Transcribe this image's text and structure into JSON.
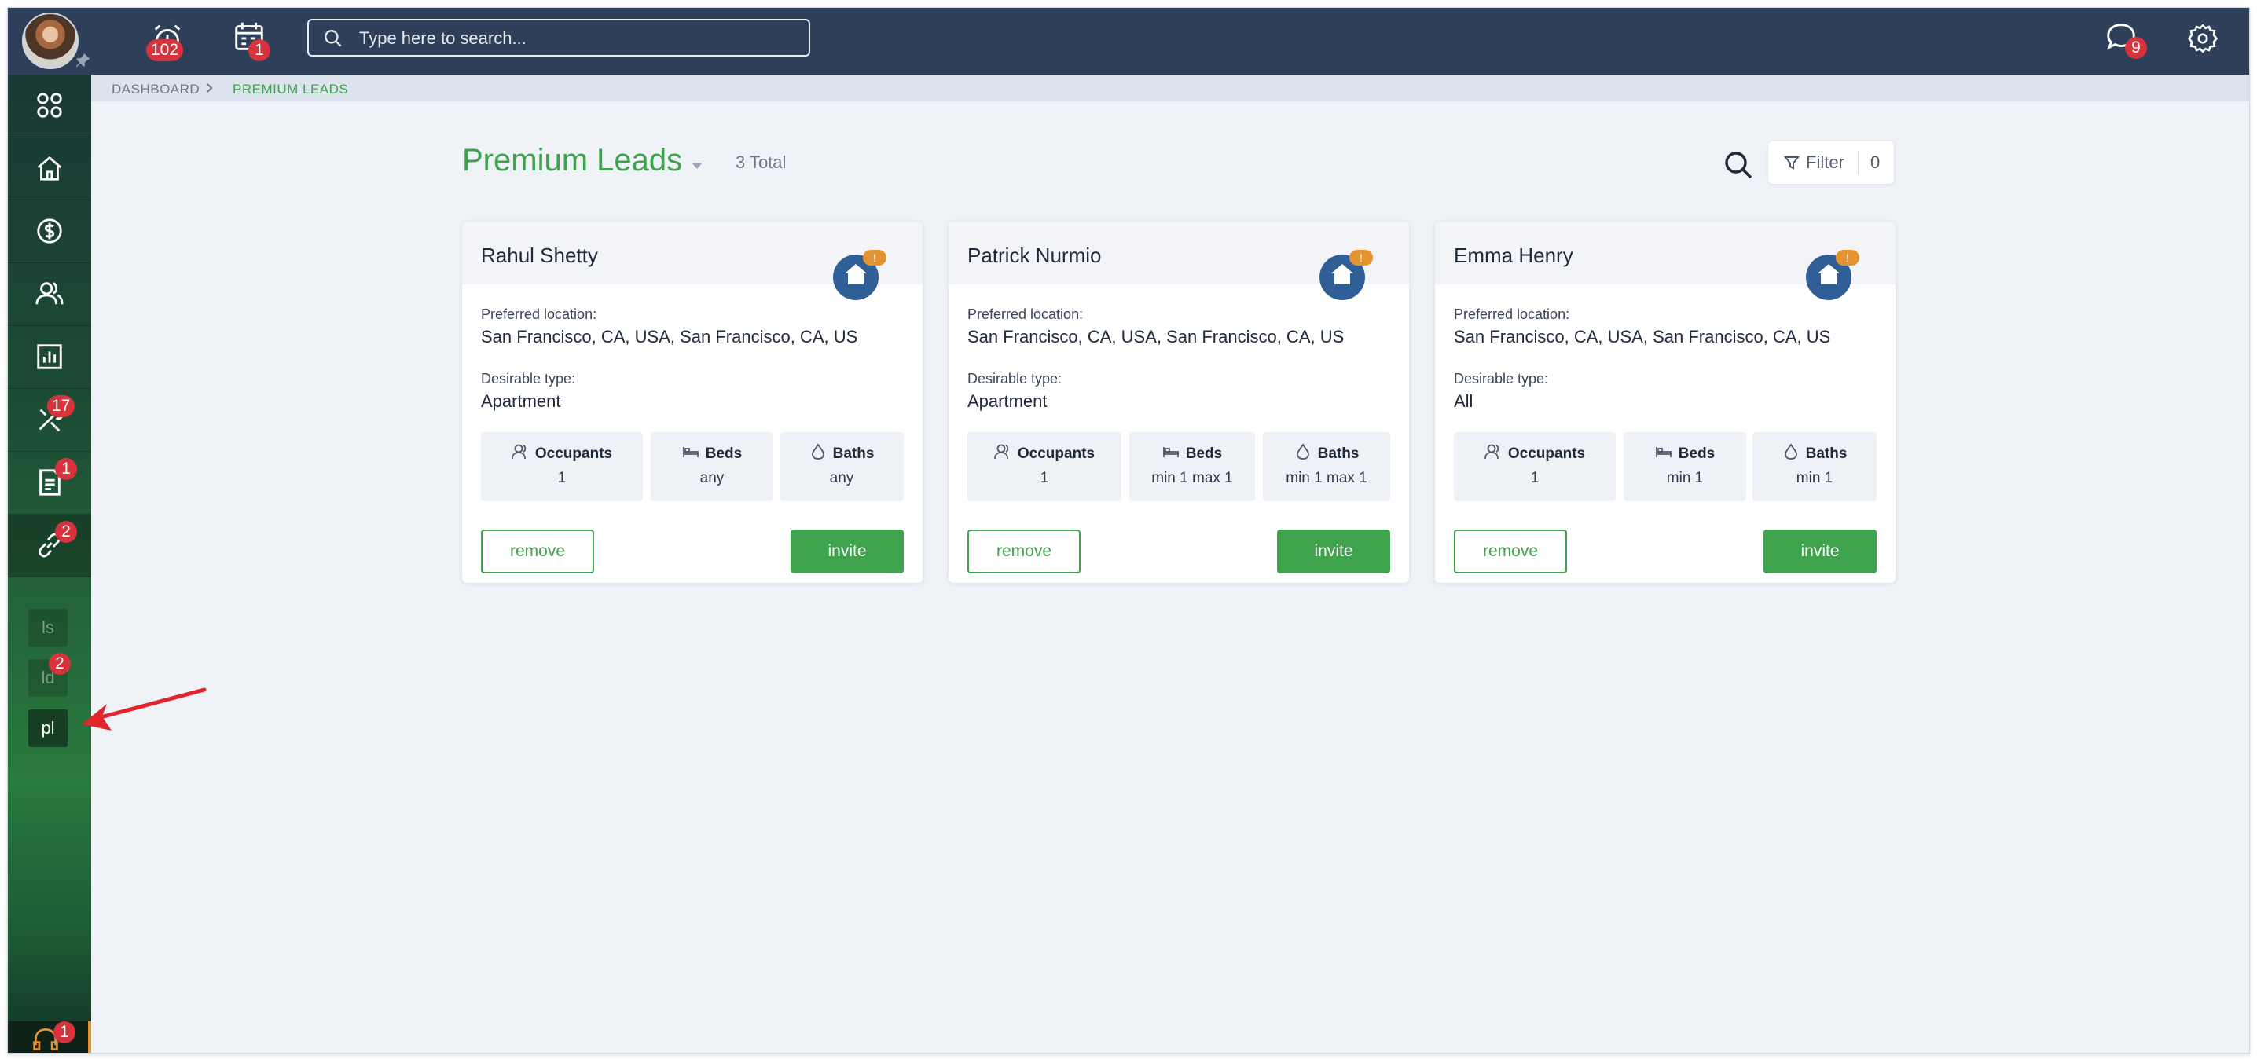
{
  "topbar": {
    "alarm_badge": "102",
    "calendar_badge": "1",
    "search_placeholder": "Type here to search...",
    "chat_badge": "9"
  },
  "sidebar": {
    "items": [
      {
        "icon": "apps-grid-icon"
      },
      {
        "icon": "home-icon"
      },
      {
        "icon": "dollar-icon"
      },
      {
        "icon": "users-icon"
      },
      {
        "icon": "chart-icon"
      },
      {
        "icon": "tools-icon",
        "badge": "17"
      },
      {
        "icon": "document-icon",
        "badge": "1"
      },
      {
        "icon": "link-icon",
        "badge": "2"
      }
    ],
    "sub_items": [
      {
        "label": "ls"
      },
      {
        "label": "ld",
        "badge": "2"
      },
      {
        "label": "pl"
      }
    ],
    "support_badge": "1"
  },
  "breadcrumb": {
    "items": [
      "DASHBOARD",
      "PREMIUM LEADS"
    ]
  },
  "header": {
    "title": "Premium Leads",
    "total": "3 Total",
    "filter_label": "Filter",
    "filter_count": "0"
  },
  "labels": {
    "preferred_location": "Preferred location:",
    "desirable_type": "Desirable type:",
    "occupants": "Occupants",
    "beds": "Beds",
    "baths": "Baths",
    "remove": "remove",
    "invite": "invite",
    "house_badge": "!"
  },
  "leads": [
    {
      "name": "Rahul Shetty",
      "location": "San Francisco, CA, USA, San Francisco, CA, US",
      "type": "Apartment",
      "occupants": "1",
      "beds": "any",
      "baths": "any"
    },
    {
      "name": "Patrick Nurmio",
      "location": "San Francisco, CA, USA, San Francisco, CA, US",
      "type": "Apartment",
      "occupants": "1",
      "beds": "min 1 max 1",
      "baths": "min 1 max 1"
    },
    {
      "name": "Emma Henry",
      "location": "San Francisco, CA, USA, San Francisco, CA, US",
      "type": "All",
      "occupants": "1",
      "beds": "min 1",
      "baths": "min 1"
    }
  ],
  "colors": {
    "topbar": "#2e4059",
    "accent_green": "#3fa34d",
    "badge_red": "#d6333c",
    "house_blue": "#2f5f96",
    "house_badge_orange": "#e39332"
  }
}
